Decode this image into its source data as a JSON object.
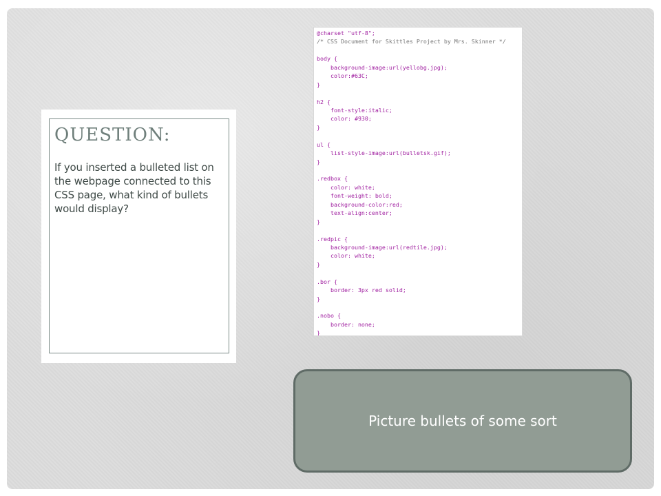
{
  "question": {
    "heading": "QUESTION:",
    "body": "If you inserted a bulleted list on the webpage connected to this CSS page, what kind of bullets would display?"
  },
  "code_lines": [
    {
      "text": "@charset \"utf-8\";",
      "color": "purple"
    },
    {
      "text": "/* CSS Document for Skittles Project by Mrs. Skinner */",
      "color": "gray"
    },
    {
      "text": "",
      "color": "blue"
    },
    {
      "text": "body {",
      "color": "purple"
    },
    {
      "text": "    background-image:url(yellobg.jpg);",
      "color": "purple"
    },
    {
      "text": "    color:#63C;",
      "color": "purple"
    },
    {
      "text": "}",
      "color": "purple"
    },
    {
      "text": "",
      "color": "blue"
    },
    {
      "text": "h2 {",
      "color": "purple"
    },
    {
      "text": "    font-style:italic;",
      "color": "purple"
    },
    {
      "text": "    color: #930;",
      "color": "purple"
    },
    {
      "text": "}",
      "color": "purple"
    },
    {
      "text": "",
      "color": "blue"
    },
    {
      "text": "ul {",
      "color": "purple"
    },
    {
      "text": "    list-style-image:url(bulletsk.gif);",
      "color": "purple"
    },
    {
      "text": "}",
      "color": "purple"
    },
    {
      "text": "",
      "color": "blue"
    },
    {
      "text": ".redbox {",
      "color": "purple"
    },
    {
      "text": "    color: white;",
      "color": "purple"
    },
    {
      "text": "    font-weight: bold;",
      "color": "purple"
    },
    {
      "text": "    background-color:red;",
      "color": "purple"
    },
    {
      "text": "    text-align:center;",
      "color": "purple"
    },
    {
      "text": "}",
      "color": "purple"
    },
    {
      "text": "",
      "color": "blue"
    },
    {
      "text": ".redpic {",
      "color": "purple"
    },
    {
      "text": "    background-image:url(redtile.jpg);",
      "color": "purple"
    },
    {
      "text": "    color: white;",
      "color": "purple"
    },
    {
      "text": "}",
      "color": "purple"
    },
    {
      "text": "",
      "color": "blue"
    },
    {
      "text": ".bor {",
      "color": "purple"
    },
    {
      "text": "    border: 3px red solid;",
      "color": "purple"
    },
    {
      "text": "}",
      "color": "purple"
    },
    {
      "text": "",
      "color": "blue"
    },
    {
      "text": ".nobo {",
      "color": "purple"
    },
    {
      "text": "    border: none;",
      "color": "purple"
    },
    {
      "text": "}",
      "color": "purple"
    }
  ],
  "answer": {
    "text": "Picture bullets of some sort"
  },
  "colors": {
    "heading": "#6f7f7b",
    "answer_fill": "#919c94",
    "answer_border": "#5f6b66",
    "code_purple": "#a020a0"
  }
}
